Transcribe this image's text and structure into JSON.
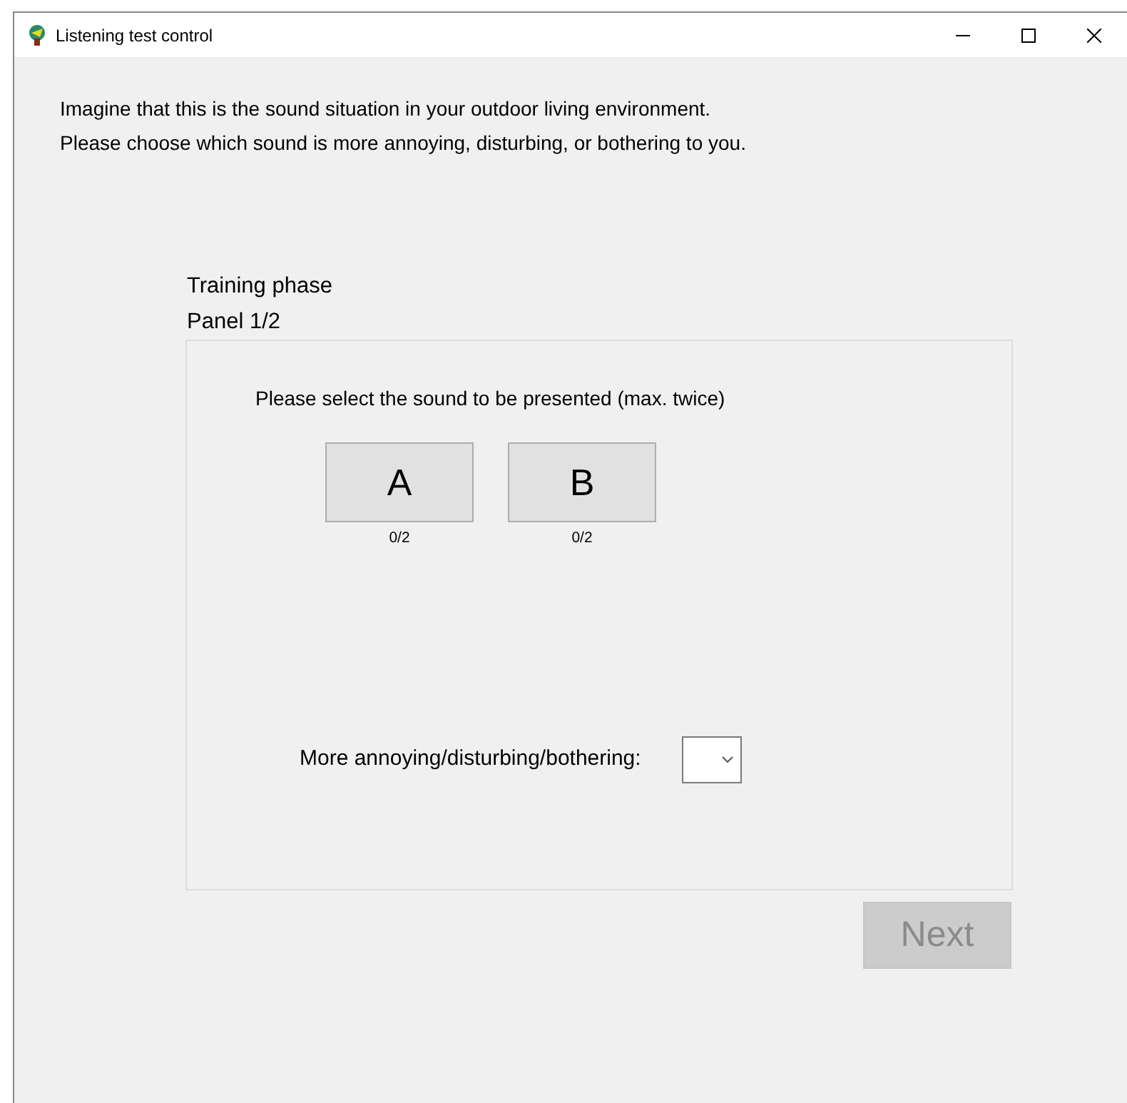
{
  "window": {
    "title": "Listening test control"
  },
  "instructions": [
    "Imagine that this is the sound situation in your outdoor living environment.",
    "Please choose which sound is more annoying, disturbing, or bothering to you."
  ],
  "phase": "Training phase",
  "panel_label": "Panel 1/2",
  "panel": {
    "prompt": "Please select the sound to be presented (max. twice)",
    "sounds": [
      {
        "label": "A",
        "count": "0/2"
      },
      {
        "label": "B",
        "count": "0/2"
      }
    ],
    "choice": {
      "label": "More annoying/disturbing/bothering:"
    }
  },
  "next_button": {
    "label": "Next",
    "disabled": true
  }
}
